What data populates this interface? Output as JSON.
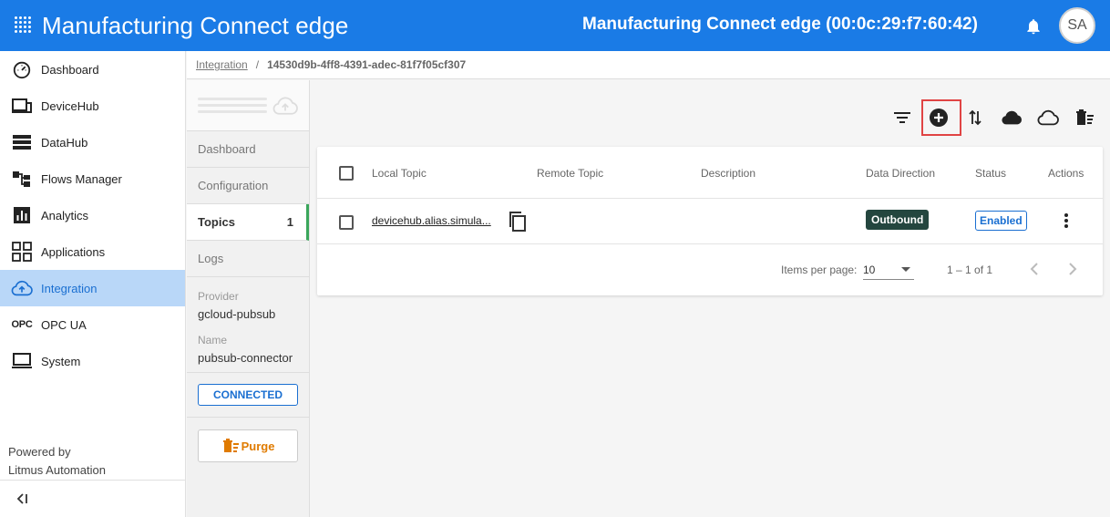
{
  "header": {
    "app_title": "Manufacturing Connect edge",
    "device_title": "Manufacturing Connect edge (00:0c:29:f7:60:42)",
    "avatar_initials": "SA",
    "brand_color": "#1a7be6"
  },
  "sidebar": {
    "items": [
      {
        "label": "Dashboard",
        "icon": "gauge-icon"
      },
      {
        "label": "DeviceHub",
        "icon": "devices-icon"
      },
      {
        "label": "DataHub",
        "icon": "storage-icon"
      },
      {
        "label": "Flows Manager",
        "icon": "flow-icon"
      },
      {
        "label": "Analytics",
        "icon": "analytics-icon"
      },
      {
        "label": "Applications",
        "icon": "grid-apps-icon"
      },
      {
        "label": "Integration",
        "icon": "cloud-upload-icon"
      },
      {
        "label": "OPC UA",
        "icon": "opc-text-icon",
        "icon_text": "OPC"
      },
      {
        "label": "System",
        "icon": "laptop-icon"
      }
    ],
    "active_item": "Integration",
    "powered_by_line1": "Powered by",
    "powered_by_line2": "Litmus Automation"
  },
  "breadcrumb": {
    "parent": "Integration",
    "separator": "/",
    "current": "14530d9b-4ff8-4391-adec-81f7f05cf307"
  },
  "connector_panel": {
    "tabs": [
      {
        "label": "Dashboard"
      },
      {
        "label": "Configuration"
      },
      {
        "label": "Topics",
        "count": "1"
      },
      {
        "label": "Logs"
      }
    ],
    "active_tab": "Topics",
    "provider_label": "Provider",
    "provider_value": "gcloud-pubsub",
    "name_label": "Name",
    "name_value": "pubsub-connector",
    "status": "CONNECTED",
    "purge_label": "Purge"
  },
  "topics_table": {
    "columns": [
      "Local Topic",
      "Remote Topic",
      "Description",
      "Data Direction",
      "Status",
      "Actions"
    ],
    "rows": [
      {
        "local_topic": "devicehub.alias.simula...",
        "remote_topic": "",
        "description": "",
        "data_direction": "Outbound",
        "status": "Enabled"
      }
    ],
    "paginator": {
      "items_per_page_label": "Items per page:",
      "items_per_page": "10",
      "range": "1 – 1 of 1"
    }
  },
  "toolbar": {
    "icons": [
      "filter-icon",
      "add-circle-icon",
      "sort-arrows-icon",
      "cloud-filled-icon",
      "cloud-outline-icon",
      "delete-list-icon"
    ]
  },
  "colors": {
    "active_nav_bg": "#b9d7f8",
    "active_tab_border": "#3aa65b",
    "outbound_badge": "#24463f",
    "enabled_badge": "#1a6fd1",
    "purge_text": "#e07b00",
    "highlight_box": "#e04444"
  }
}
